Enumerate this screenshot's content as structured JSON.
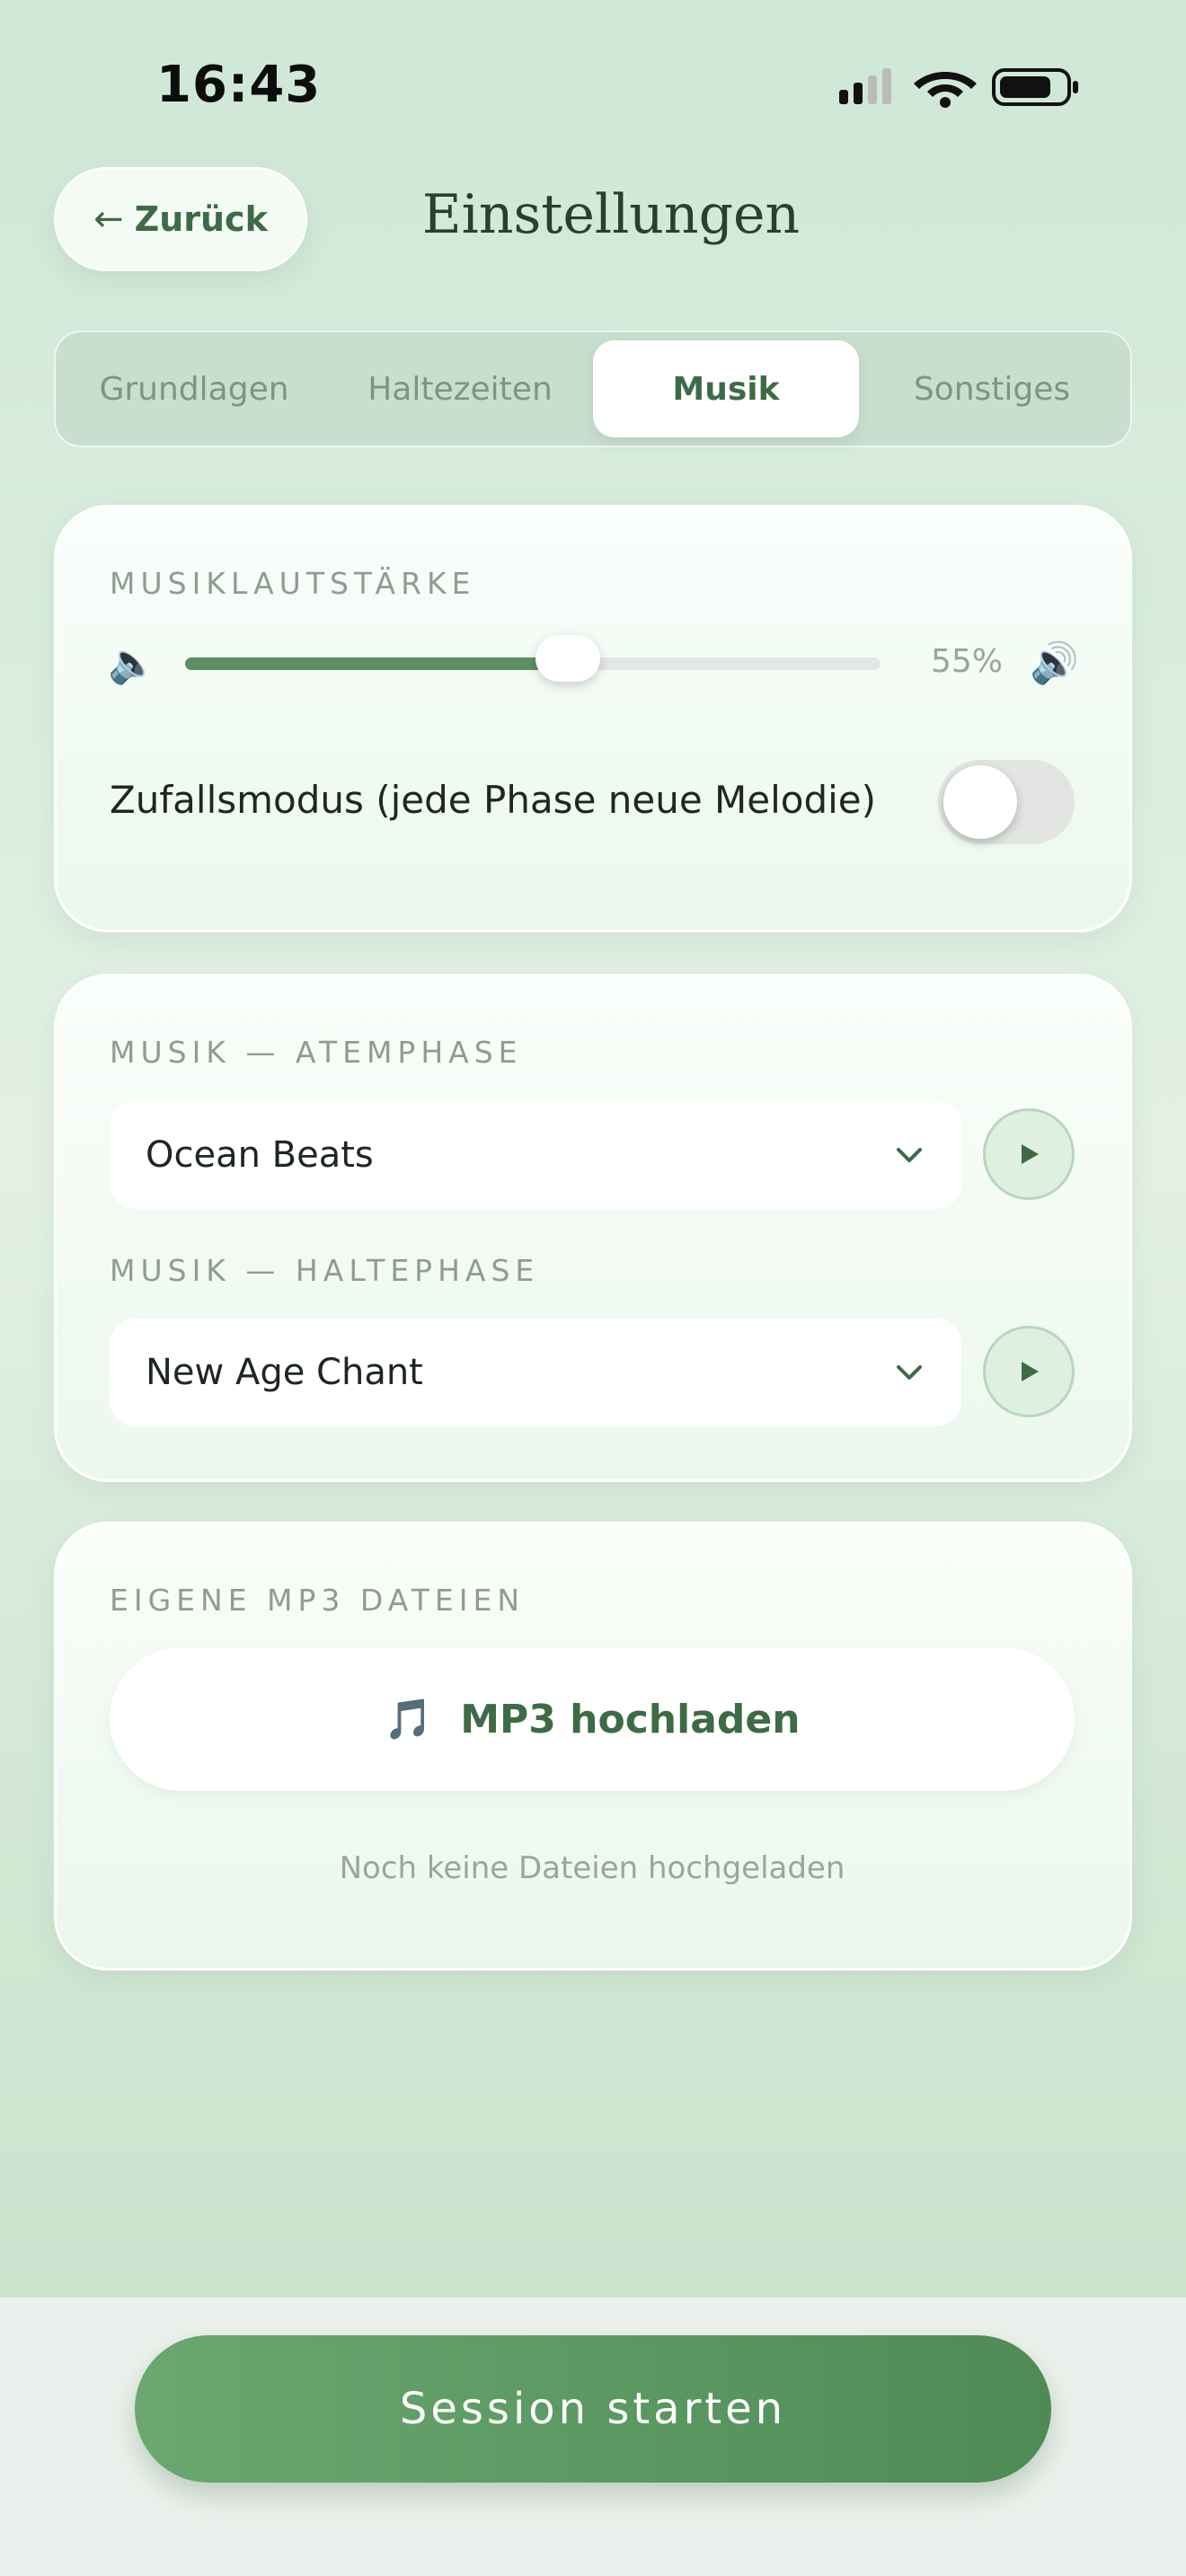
{
  "status_bar": {
    "time": "16:43"
  },
  "header": {
    "back_label": "Zurück",
    "title": "Einstellungen"
  },
  "tabs": [
    {
      "label": "Grundlagen",
      "active": false
    },
    {
      "label": "Haltezeiten",
      "active": false
    },
    {
      "label": "Musik",
      "active": true
    },
    {
      "label": "Sonstiges",
      "active": false
    }
  ],
  "volume_card": {
    "label": "MUSIKLAUTSTÄRKE",
    "volume_percent": 55,
    "volume_text": "55%",
    "shuffle_label": "Zufallsmodus (jede Phase neue Melodie)",
    "shuffle_enabled": false
  },
  "music_card": {
    "breath_label": "MUSIK — ATEMPHASE",
    "breath_selected": "Ocean Beats",
    "hold_label": "MUSIK — HALTEPHASE",
    "hold_selected": "New Age Chant"
  },
  "mp3_card": {
    "label": "EIGENE MP3 DATEIEN",
    "upload_icon": "🎵",
    "upload_label": "MP3 hochladen",
    "empty_note": "Noch keine Dateien hochgeladen"
  },
  "footer": {
    "start_label": "Session starten"
  },
  "colors": {
    "accent": "#5c8f61",
    "accent_dark": "#3d6b45",
    "background": "#d6ebd9"
  }
}
